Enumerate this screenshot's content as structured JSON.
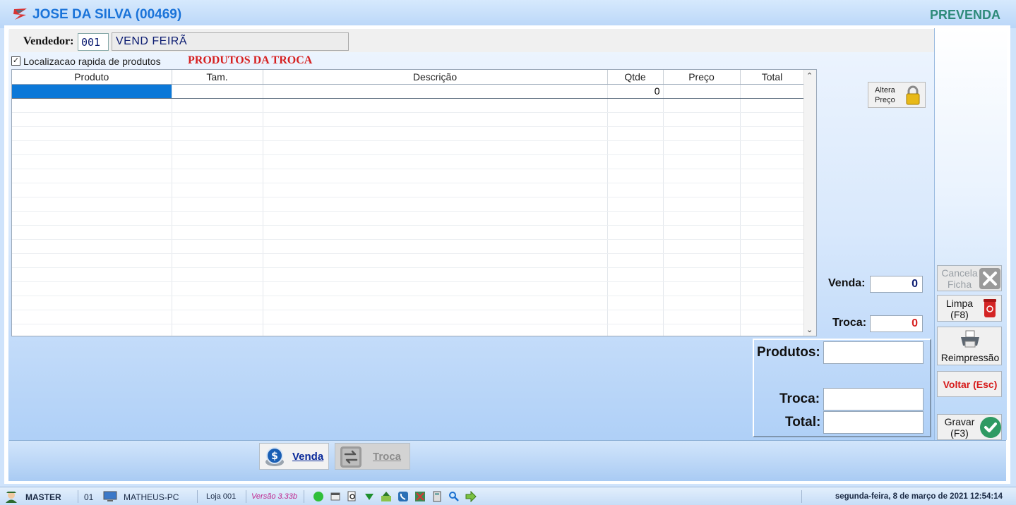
{
  "title": {
    "name": "JOSE DA SILVA (00469)",
    "mode": "PREVENDA"
  },
  "vendedor": {
    "label": "Vendedor:",
    "code": "001",
    "name": "VEND FEIRÃ"
  },
  "quick_search": {
    "label": "Localizacao rapida de produtos",
    "checked": true
  },
  "section_title": "PRODUTOS DA TROCA",
  "grid": {
    "columns": [
      "Produto",
      "Tam.",
      "Descrição",
      "Qtde",
      "Preço",
      "Total"
    ],
    "rows": [
      {
        "produto": "",
        "tam": "",
        "descricao": "",
        "qtde": "0",
        "preco": "",
        "total": ""
      }
    ]
  },
  "alter_price": {
    "line1": "Altera",
    "line2": "Preço"
  },
  "summary": {
    "venda_label": "Venda:",
    "venda_value": "0",
    "troca_label": "Troca:",
    "troca_value": "0"
  },
  "totals": {
    "produtos_label": "Produtos:",
    "produtos_value": "",
    "troca_label": "Troca:",
    "troca_value": "",
    "total_label": "Total:",
    "total_value": ""
  },
  "actions": {
    "cancela_line1": "Cancela",
    "cancela_line2": "Ficha",
    "limpa_line1": "Limpa",
    "limpa_line2": "(F8)",
    "reimpressao": "Reimpressão",
    "voltar": "Voltar (Esc)",
    "gravar_line1": "Gravar",
    "gravar_line2": "(F3)"
  },
  "tabs": {
    "venda": "Venda",
    "troca": "Troca"
  },
  "status": {
    "user": "MASTER",
    "terminal": "01",
    "pc": "MATHEUS-PC",
    "loja": "Loja 001",
    "versao": "Versão 3.33b",
    "datetime": "segunda-feira, 8 de março de 2021 12:54:14"
  },
  "colors": {
    "accent": "#1a73d9",
    "mode": "#2e8a7a",
    "troca_title": "#d62020",
    "venda_value": "#0a1a70",
    "troca_value": "#d62020",
    "voltar": "#d61a1a",
    "selection": "#0b78d8"
  }
}
